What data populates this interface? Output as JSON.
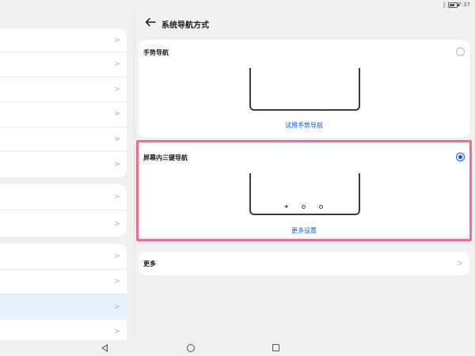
{
  "status_bar": {
    "time": "7:37",
    "bluetooth_icon": "bluetooth-icon",
    "battery_icon": "battery-icon"
  },
  "header": {
    "back_icon": "arrow-left-icon",
    "title": "系统导航方式"
  },
  "options": {
    "gesture": {
      "label": "手势导航",
      "link": "试用手势导航",
      "selected": false
    },
    "three_key": {
      "label": "屏幕内三键导航",
      "link": "更多设置",
      "selected": true
    }
  },
  "more": {
    "label": "更多"
  },
  "colors": {
    "accent": "#0a59f7",
    "highlight": "#ea6f93",
    "selected_row": "#e6f0fd"
  },
  "left_pane": {
    "groups": [
      {
        "rows": 6,
        "selected_index": -1
      },
      {
        "rows": 2,
        "selected_index": -1
      },
      {
        "rows": 4,
        "selected_index": 2
      }
    ]
  },
  "system_nav": {
    "back_icon": "triangle-back-icon",
    "home_icon": "circle-home-icon",
    "recent_icon": "square-recent-icon"
  }
}
